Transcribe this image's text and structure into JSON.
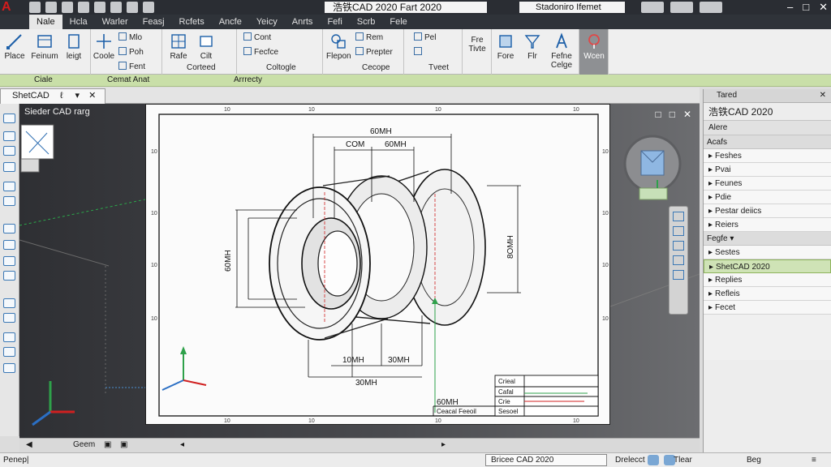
{
  "app": {
    "logo": "A",
    "title": "浩铁CAD 2020 Fart 2020",
    "search": "Stadoniro Ifemet"
  },
  "tabs": [
    "Nale",
    "Hcla",
    "Warler",
    "Feasj",
    "Rcfets",
    "Ancfe",
    "Yeicy",
    "Anrts",
    "Fefi",
    "Scrb",
    "Fele"
  ],
  "ribbon": {
    "place": "Place",
    "feinum": "Feinum",
    "leigt": "leigt",
    "coole": "Coole",
    "mo": "Mlo",
    "poh": "Poh",
    "fent": "Fent",
    "rfe": "Rafe",
    "cilt": "Cilt",
    "corteed": "Corteed",
    "cont": "Cont",
    "fecfce": "Fecfce",
    "coltogle": "Coltogle",
    "rem": "Rem",
    "flepon": "Flepon",
    "prepter": "Prepter",
    "cecope": "Cecope",
    "pel": "Pel",
    "tveet": "Tveet",
    "fre": "Fre",
    "tivte": "Tivte",
    "fore": "Fore",
    "flr": "Flr",
    "fefne": "Fefne",
    "colge": "Celge",
    "wcen": "Wcen"
  },
  "panel_labels": {
    "ciale": "Ciale",
    "cemat": "Cemat Anat",
    "arrrecty": "Arrrecty"
  },
  "file_tab": "ShetCAD",
  "file_tab_extra": "ℓ",
  "viewport": {
    "label": "Sieder CAD rarg",
    "ctrl_restore": "□",
    "ctrl_max": "□",
    "ctrl_close": "✕"
  },
  "drawing": {
    "dim_top": "60MH",
    "dim_top_left": "COM",
    "dim_top_right": "60MH",
    "dim_left": "60MH",
    "dim_right": "8OMH",
    "dim_bottom_left": "10MH",
    "dim_bottom_right": "30MH",
    "dim_bottom": "30MH",
    "dim_tb": "60MH",
    "title_block_1": "Crieal",
    "title_block_2": "Cafal",
    "title_block_3": "Crie",
    "title_block_4": "Ceacal Feeoil",
    "title_block_5": "Sesoel"
  },
  "bottom": {
    "tab_model": "Geem"
  },
  "command": {
    "prompt": "Penep|",
    "status_box": "Bricee CAD 2020",
    "status2": "Drelecct",
    "tbar": "Tlear",
    "beg": "Beg"
  },
  "palette": {
    "header": "Tared",
    "title": "浩铁CAD 2020",
    "sub": "Alere",
    "section_top": "Acafs",
    "items_top": [
      "Feshes",
      "Pvai",
      "Feunes",
      "Pdie",
      "Pestar deiics",
      "Reiers"
    ],
    "section_mid": "Fegfe",
    "items_mid": [
      "Sestes",
      "ShetCAD 2020",
      "Replies",
      "Refleis",
      "Fecet"
    ]
  }
}
